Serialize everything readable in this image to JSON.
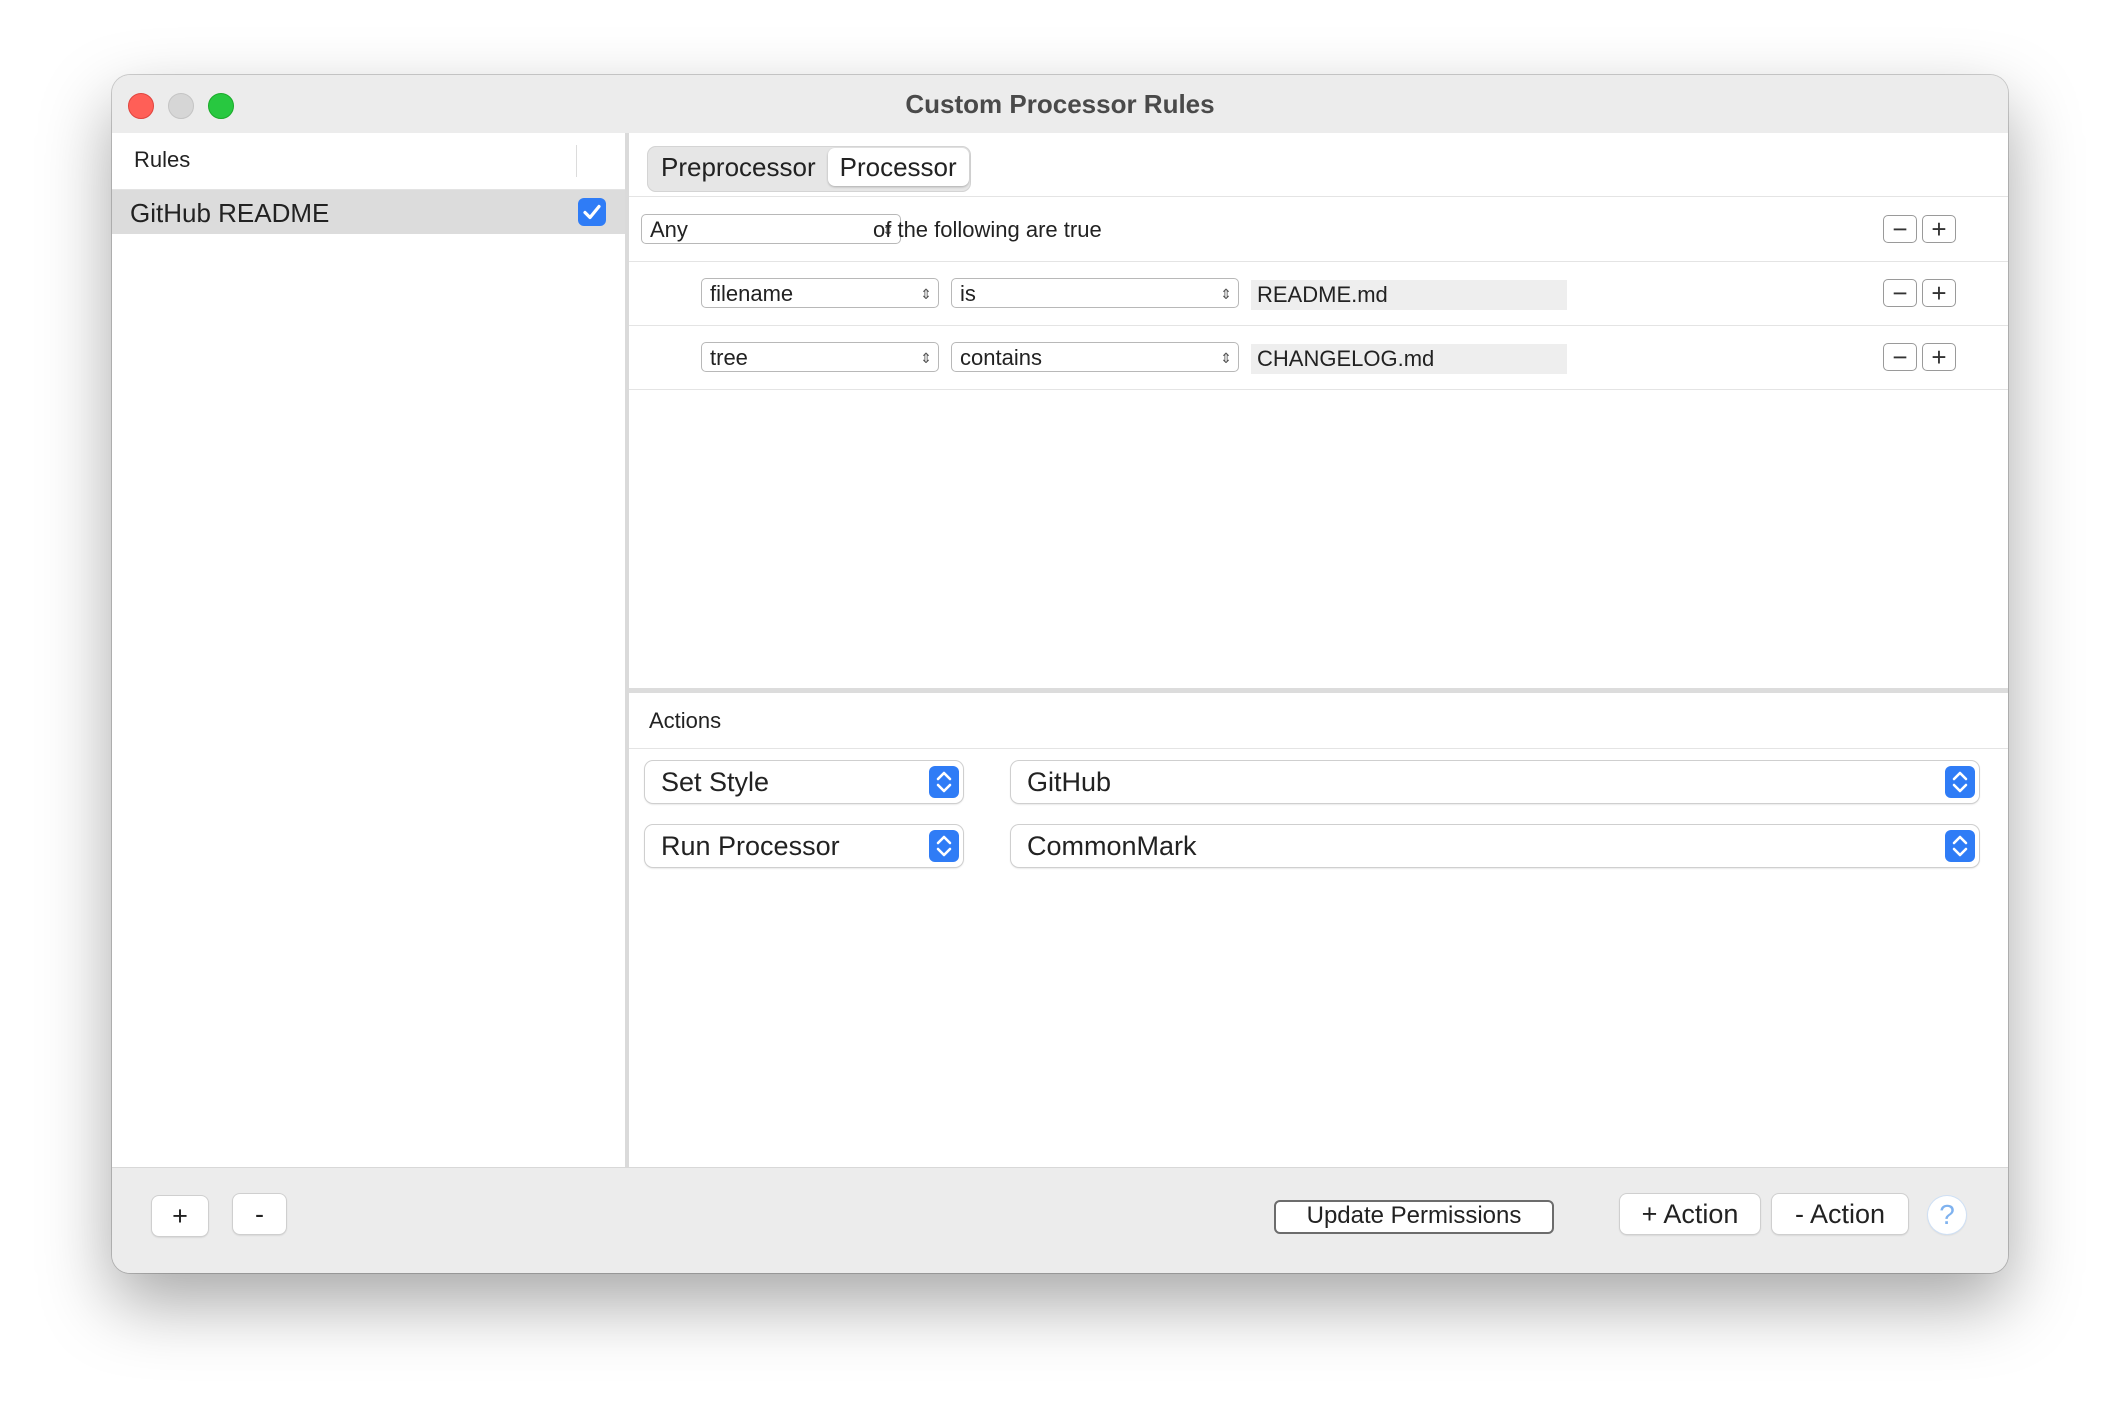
{
  "window": {
    "title": "Custom Processor Rules"
  },
  "sidebar": {
    "header": "Rules",
    "rules": [
      {
        "label": "GitHub README",
        "enabled": true
      }
    ]
  },
  "tabs": {
    "items": [
      "Preprocessor",
      "Processor"
    ],
    "selected": "Processor"
  },
  "predicates": {
    "match": {
      "selected": "Any",
      "suffix": "of the following are true"
    },
    "rows": [
      {
        "field": "filename",
        "operator": "is",
        "value": "README.md"
      },
      {
        "field": "tree",
        "operator": "contains",
        "value": "CHANGELOG.md"
      }
    ],
    "minus_label": "−",
    "plus_label": "+"
  },
  "actions": {
    "header": "Actions",
    "rows": [
      {
        "action": "Set Style",
        "value": "GitHub"
      },
      {
        "action": "Run Processor",
        "value": "CommonMark"
      }
    ]
  },
  "bottom": {
    "add_rule": "+",
    "remove_rule": "-",
    "update_permissions": "Update Permissions",
    "add_action": "+ Action",
    "remove_action": "- Action",
    "help": "?"
  },
  "colors": {
    "accent": "#2f7cf6",
    "close": "#ff5f57",
    "minimize": "#d6d6d6",
    "zoom": "#28c840",
    "selection": "#dcdcdc"
  },
  "icons": {
    "checkbox": "checkmark-icon",
    "popup_chevron": "chevron-up-down-icon",
    "help": "question-mark-icon"
  }
}
